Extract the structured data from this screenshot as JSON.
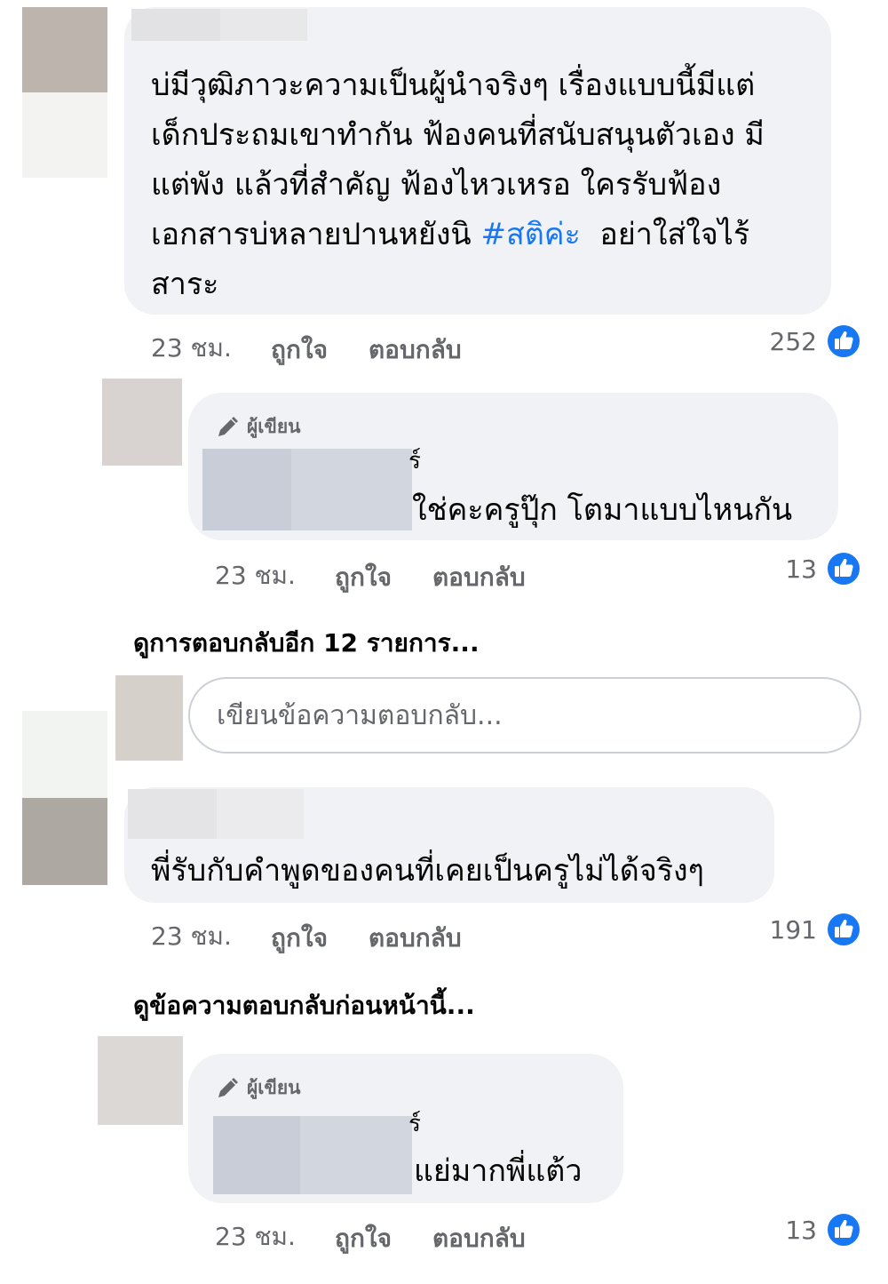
{
  "comments": [
    {
      "text_parts": [
        "บ่มีวุฒิภาวะความเป็นผู้นำจริงๆ เรื่องแบบนี้มีแต่\nเด็กประถมเขาทำกัน ฟ้องคนที่สนับสนุนตัวเอง มี\nแต่พัง แล้วที่สำคัญ ฟ้องไหวเหรอ ใครรับฟ้อง\nเอกสารบ่หลายปานหยังนิ ",
        "#สติค่ะ",
        "  อย่าใส่ใจไร้\nสาระ"
      ],
      "time": "23 ชม.",
      "like_label": "ถูกใจ",
      "reply_label": "ตอบกลับ",
      "like_count": "252"
    },
    {
      "author_badge": "ผู้เขียน",
      "name_fragment": "ร์",
      "text": "ใช่คะครูปุ๊ก โตมาแบบไหนกัน",
      "time": "23 ชม.",
      "like_label": "ถูกใจ",
      "reply_label": "ตอบกลับ",
      "like_count": "13"
    },
    {
      "text": "พี่รับกับคำพูดของคนที่เคยเป็นครูไม่ได้จริงๆ",
      "time": "23 ชม.",
      "like_label": "ถูกใจ",
      "reply_label": "ตอบกลับ",
      "like_count": "191"
    },
    {
      "author_badge": "ผู้เขียน",
      "name_fragment": "ร์",
      "text": "แย่มากพี่แต้ว",
      "time": "23 ชม.",
      "like_label": "ถูกใจ",
      "reply_label": "ตอบกลับ",
      "like_count": "13"
    }
  ],
  "view_more_replies": "ดูการตอบกลับอีก 12 รายการ...",
  "reply_input_placeholder": "เขียนข้อความตอบกลับ...",
  "view_previous_replies": "ดูข้อความตอบกลับก่อนหน้านี้...",
  "colors": {
    "bubble": "#f0f2f5",
    "hashtag": "#1877f2",
    "meta": "#65676b",
    "like_icon": "#1877f2"
  },
  "icons": {
    "like": "thumbs-up-icon",
    "author": "pencil-icon"
  }
}
